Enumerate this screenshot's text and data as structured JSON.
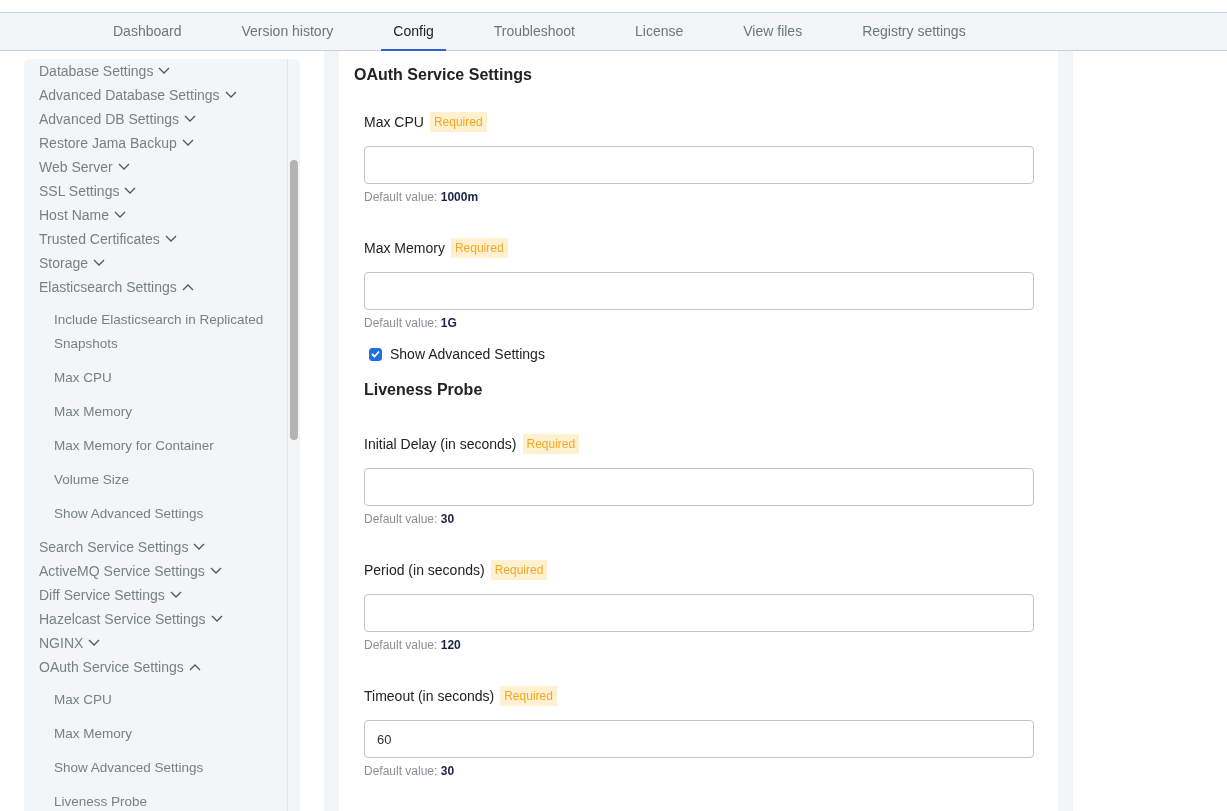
{
  "tabs": [
    {
      "label": "Dashboard",
      "selected": false
    },
    {
      "label": "Version history",
      "selected": false
    },
    {
      "label": "Config",
      "selected": true
    },
    {
      "label": "Troubleshoot",
      "selected": false
    },
    {
      "label": "License",
      "selected": false
    },
    {
      "label": "View files",
      "selected": false
    },
    {
      "label": "Registry settings",
      "selected": false
    }
  ],
  "sidebar": {
    "items": [
      {
        "label": "Database Settings",
        "expanded": false
      },
      {
        "label": "Advanced Database Settings",
        "expanded": false
      },
      {
        "label": "Advanced DB Settings",
        "expanded": false
      },
      {
        "label": "Restore Jama Backup",
        "expanded": false
      },
      {
        "label": "Web Server",
        "expanded": false
      },
      {
        "label": "SSL Settings",
        "expanded": false
      },
      {
        "label": "Host Name",
        "expanded": false
      },
      {
        "label": "Trusted Certificates",
        "expanded": false
      },
      {
        "label": "Storage",
        "expanded": false
      },
      {
        "label": "Elasticsearch Settings",
        "expanded": true,
        "children": [
          {
            "label": "Include Elasticsearch in Replicated Snapshots"
          },
          {
            "label": "Max CPU"
          },
          {
            "label": "Max Memory"
          },
          {
            "label": "Max Memory for Container"
          },
          {
            "label": "Volume Size"
          },
          {
            "label": "Show Advanced Settings"
          }
        ]
      },
      {
        "label": "Search Service Settings",
        "expanded": false
      },
      {
        "label": "ActiveMQ Service Settings",
        "expanded": false
      },
      {
        "label": "Diff Service Settings",
        "expanded": false
      },
      {
        "label": "Hazelcast Service Settings",
        "expanded": false
      },
      {
        "label": "NGINX",
        "expanded": false
      },
      {
        "label": "OAuth Service Settings",
        "expanded": true,
        "children": [
          {
            "label": "Max CPU"
          },
          {
            "label": "Max Memory"
          },
          {
            "label": "Show Advanced Settings"
          },
          {
            "label": "Liveness Probe"
          }
        ]
      }
    ]
  },
  "section": {
    "title": "OAuth Service Settings",
    "items": [
      {
        "kind": "field",
        "label": "Max CPU",
        "badge": "Required",
        "value": "",
        "default_label": "Default value:",
        "default_value": "1000m"
      },
      {
        "kind": "field",
        "label": "Max Memory",
        "badge": "Required",
        "value": "",
        "default_label": "Default value:",
        "default_value": "1G"
      },
      {
        "kind": "checkbox",
        "label": "Show Advanced Settings",
        "checked": true
      },
      {
        "kind": "heading",
        "label": "Liveness Probe"
      },
      {
        "kind": "field",
        "label": "Initial Delay (in seconds)",
        "badge": "Required",
        "value": "",
        "default_label": "Default value:",
        "default_value": "30"
      },
      {
        "kind": "field",
        "label": "Period (in seconds)",
        "badge": "Required",
        "value": "",
        "default_label": "Default value:",
        "default_value": "120"
      },
      {
        "kind": "field",
        "label": "Timeout (in seconds)",
        "badge": "Required",
        "value": "60",
        "default_label": "Default value:",
        "default_value": "30"
      }
    ]
  }
}
